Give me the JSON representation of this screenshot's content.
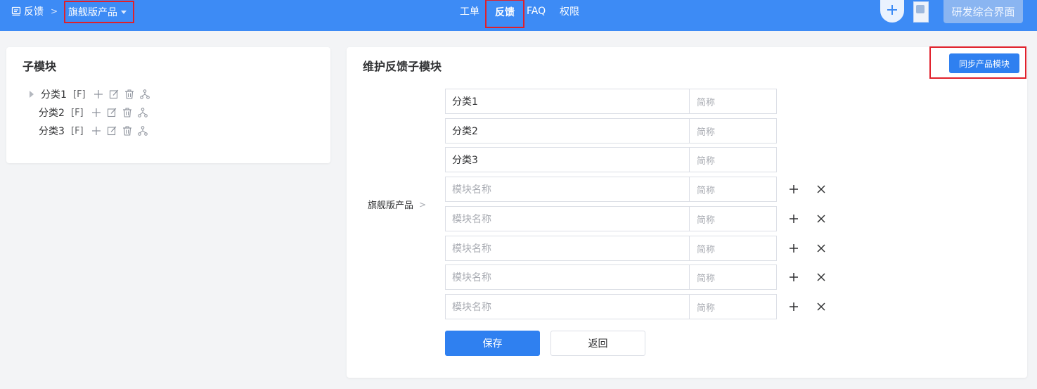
{
  "header": {
    "breadcrumb_root": "反馈",
    "product_selector": "旗舰版产品",
    "nav": [
      "工单",
      "反馈",
      "FAQ",
      "权限"
    ],
    "active_nav": "反馈",
    "workspace_button": "研发综合界面",
    "accent_color": "#3d8bf5"
  },
  "left_card": {
    "title": "子模块",
    "tree": [
      {
        "label": "分类1",
        "tag": "[F]",
        "expandable": true
      },
      {
        "label": "分类2",
        "tag": "[F]",
        "expandable": false
      },
      {
        "label": "分类3",
        "tag": "[F]",
        "expandable": false
      }
    ]
  },
  "right_card": {
    "title": "维护反馈子模块",
    "sync_button": "同步产品模块",
    "parent_label": "旗舰版产品",
    "rows": [
      {
        "name": "分类1",
        "short_placeholder": "简称",
        "name_placeholder": "模块名称",
        "removable": false
      },
      {
        "name": "分类2",
        "short_placeholder": "简称",
        "name_placeholder": "模块名称",
        "removable": false
      },
      {
        "name": "分类3",
        "short_placeholder": "简称",
        "name_placeholder": "模块名称",
        "removable": false
      },
      {
        "name": "",
        "short_placeholder": "简称",
        "name_placeholder": "模块名称",
        "removable": true
      },
      {
        "name": "",
        "short_placeholder": "简称",
        "name_placeholder": "模块名称",
        "removable": true
      },
      {
        "name": "",
        "short_placeholder": "简称",
        "name_placeholder": "模块名称",
        "removable": true
      },
      {
        "name": "",
        "short_placeholder": "简称",
        "name_placeholder": "模块名称",
        "removable": true
      },
      {
        "name": "",
        "short_placeholder": "简称",
        "name_placeholder": "模块名称",
        "removable": true
      }
    ],
    "save_button": "保存",
    "back_button": "返回"
  }
}
